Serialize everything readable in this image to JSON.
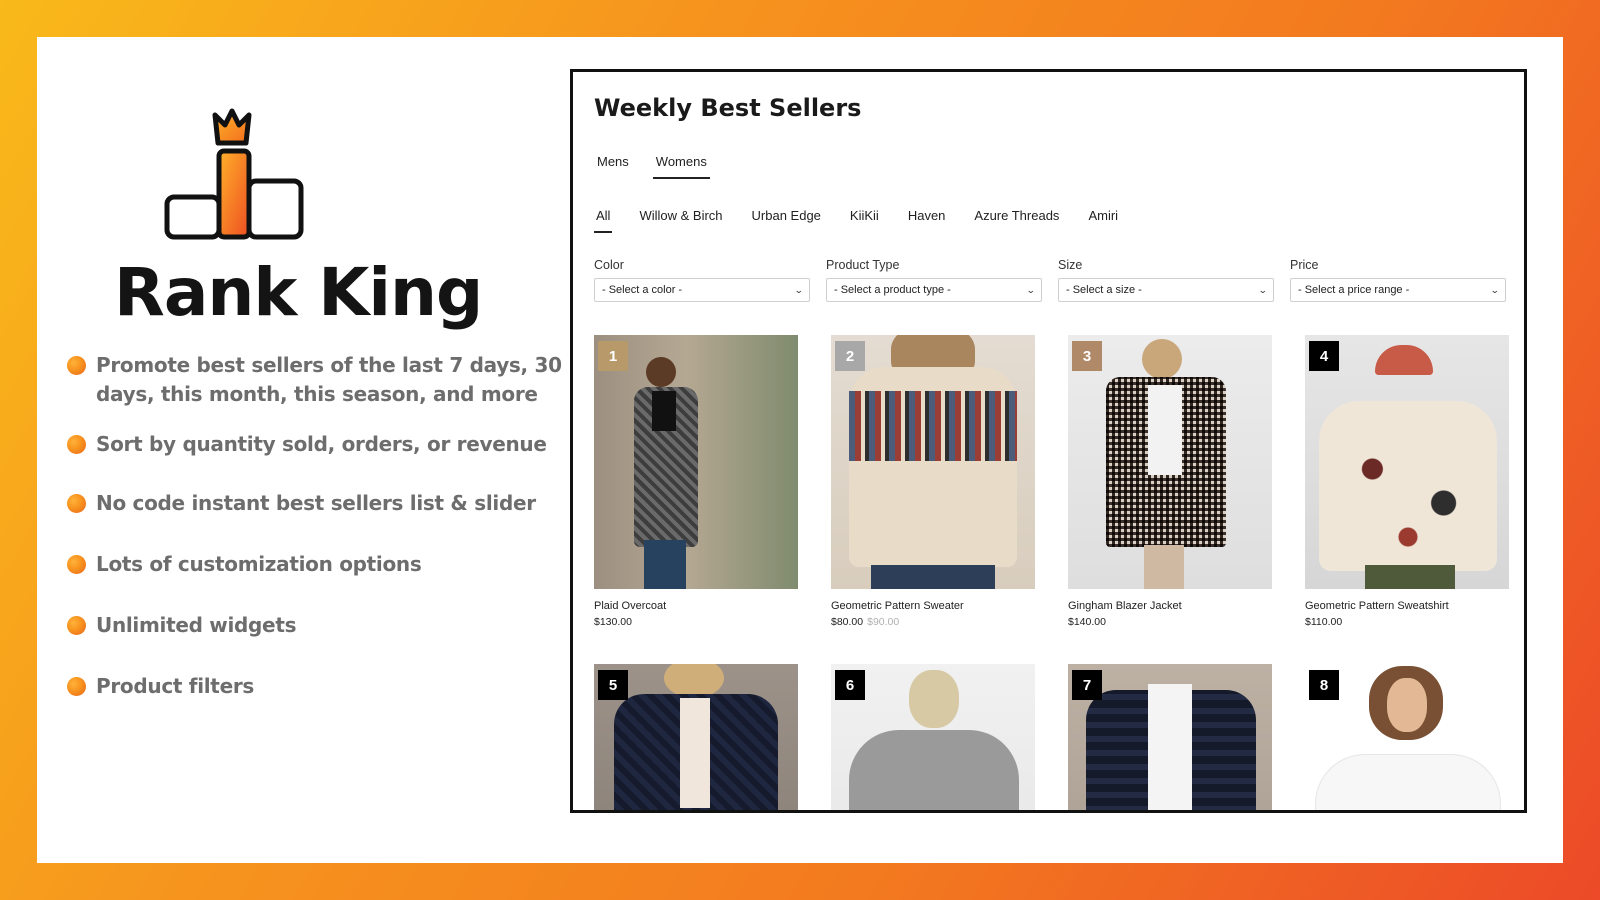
{
  "brand": {
    "name": "Rank King"
  },
  "features": [
    "Promote best sellers of the last 7 days, 30 days, this month, this season, and more",
    "Sort by quantity sold, orders, or revenue",
    "No code instant best sellers list & slider",
    "Lots of customization options",
    "Unlimited widgets",
    "Product filters"
  ],
  "widget": {
    "title": "Weekly Best Sellers",
    "gender_tabs": [
      {
        "label": "Mens",
        "active": false
      },
      {
        "label": "Womens",
        "active": true
      }
    ],
    "brand_tabs": [
      {
        "label": "All",
        "active": true
      },
      {
        "label": "Willow & Birch",
        "active": false
      },
      {
        "label": "Urban Edge",
        "active": false
      },
      {
        "label": "KiiKii",
        "active": false
      },
      {
        "label": "Haven",
        "active": false
      },
      {
        "label": "Azure Threads",
        "active": false
      },
      {
        "label": "Amiri",
        "active": false
      }
    ],
    "filters": [
      {
        "label": "Color",
        "value": "- Select a color -"
      },
      {
        "label": "Product Type",
        "value": "- Select a product type -"
      },
      {
        "label": "Size",
        "value": "- Select a size -"
      },
      {
        "label": "Price",
        "value": "- Select a price range -"
      }
    ],
    "products": [
      {
        "rank": "1",
        "name": "Plaid Overcoat",
        "price": "$130.00",
        "compare_price": "",
        "badge_color": "#b89a6a"
      },
      {
        "rank": "2",
        "name": "Geometric Pattern Sweater",
        "price": "$80.00",
        "compare_price": "$90.00",
        "badge_color": "#a8a8a8"
      },
      {
        "rank": "3",
        "name": "Gingham Blazer Jacket",
        "price": "$140.00",
        "compare_price": "",
        "badge_color": "#b08a68"
      },
      {
        "rank": "4",
        "name": "Geometric Pattern Sweatshirt",
        "price": "$110.00",
        "compare_price": "",
        "badge_color": "#000000"
      },
      {
        "rank": "5",
        "name": "",
        "price": "",
        "compare_price": "",
        "badge_color": "#000000"
      },
      {
        "rank": "6",
        "name": "",
        "price": "",
        "compare_price": "",
        "badge_color": "#000000"
      },
      {
        "rank": "7",
        "name": "",
        "price": "",
        "compare_price": "",
        "badge_color": "#000000"
      },
      {
        "rank": "8",
        "name": "",
        "price": "",
        "compare_price": "",
        "badge_color": "#000000"
      }
    ]
  },
  "colors": {
    "accent_orange": "#f7931e",
    "accent_red": "#ec4a28",
    "feature_text": "#6d6d6d"
  }
}
